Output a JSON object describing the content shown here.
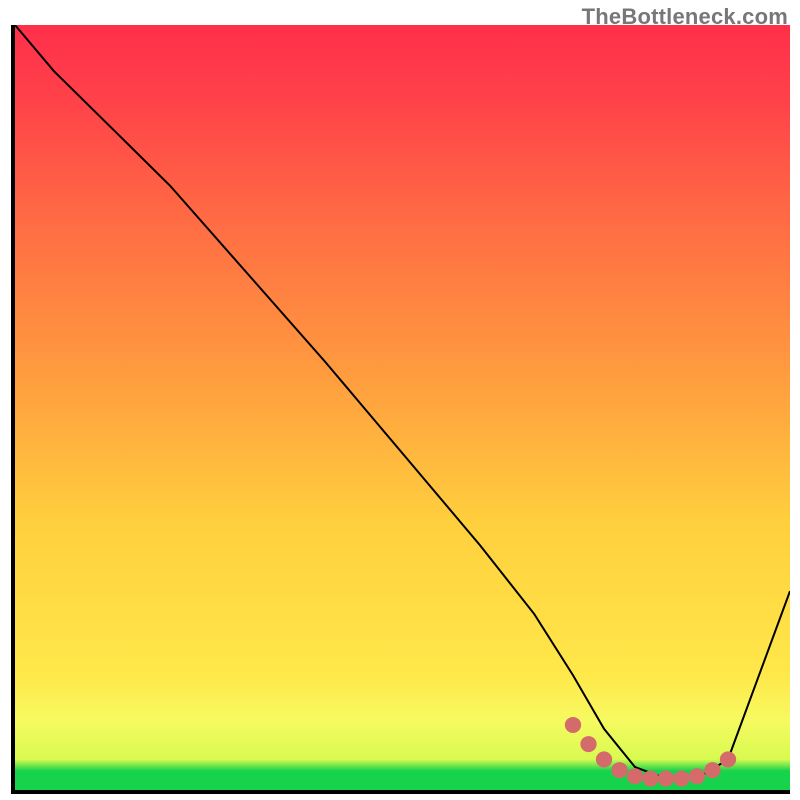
{
  "watermark": "TheBottleneck.com",
  "chart_data": {
    "type": "line",
    "title": "",
    "xlabel": "",
    "ylabel": "",
    "xlim": [
      0,
      100
    ],
    "ylim": [
      0,
      100
    ],
    "gradient_bands": [
      {
        "name": "green",
        "color": "#17d34b",
        "y0": 0,
        "y1": 3
      },
      {
        "name": "lime",
        "color": "#c8fa32",
        "y0": 3,
        "y1": 10
      },
      {
        "name": "yellow",
        "color": "#ffe530",
        "y0": 10,
        "y1": 45
      },
      {
        "name": "orange",
        "color": "#ff8a3a",
        "y0": 45,
        "y1": 75
      },
      {
        "name": "red",
        "color": "#ff2f4a",
        "y0": 75,
        "y1": 100
      }
    ],
    "series": [
      {
        "name": "bottleneck-curve",
        "color": "#000000",
        "x": [
          0,
          5,
          13,
          20,
          30,
          40,
          50,
          60,
          67,
          72,
          76,
          80,
          84,
          88,
          92,
          100
        ],
        "values": [
          100,
          94,
          86,
          79,
          67.5,
          56,
          44,
          32,
          23,
          15,
          8,
          3,
          1.5,
          1.5,
          4,
          26
        ]
      },
      {
        "name": "highlight-dots",
        "color": "#d46a6a",
        "x": [
          72,
          74,
          76,
          78,
          80,
          82,
          84,
          86,
          88,
          90,
          92
        ],
        "values": [
          8.5,
          6.0,
          4.0,
          2.6,
          1.8,
          1.5,
          1.5,
          1.5,
          1.8,
          2.6,
          4.0
        ]
      }
    ],
    "annotations": []
  }
}
